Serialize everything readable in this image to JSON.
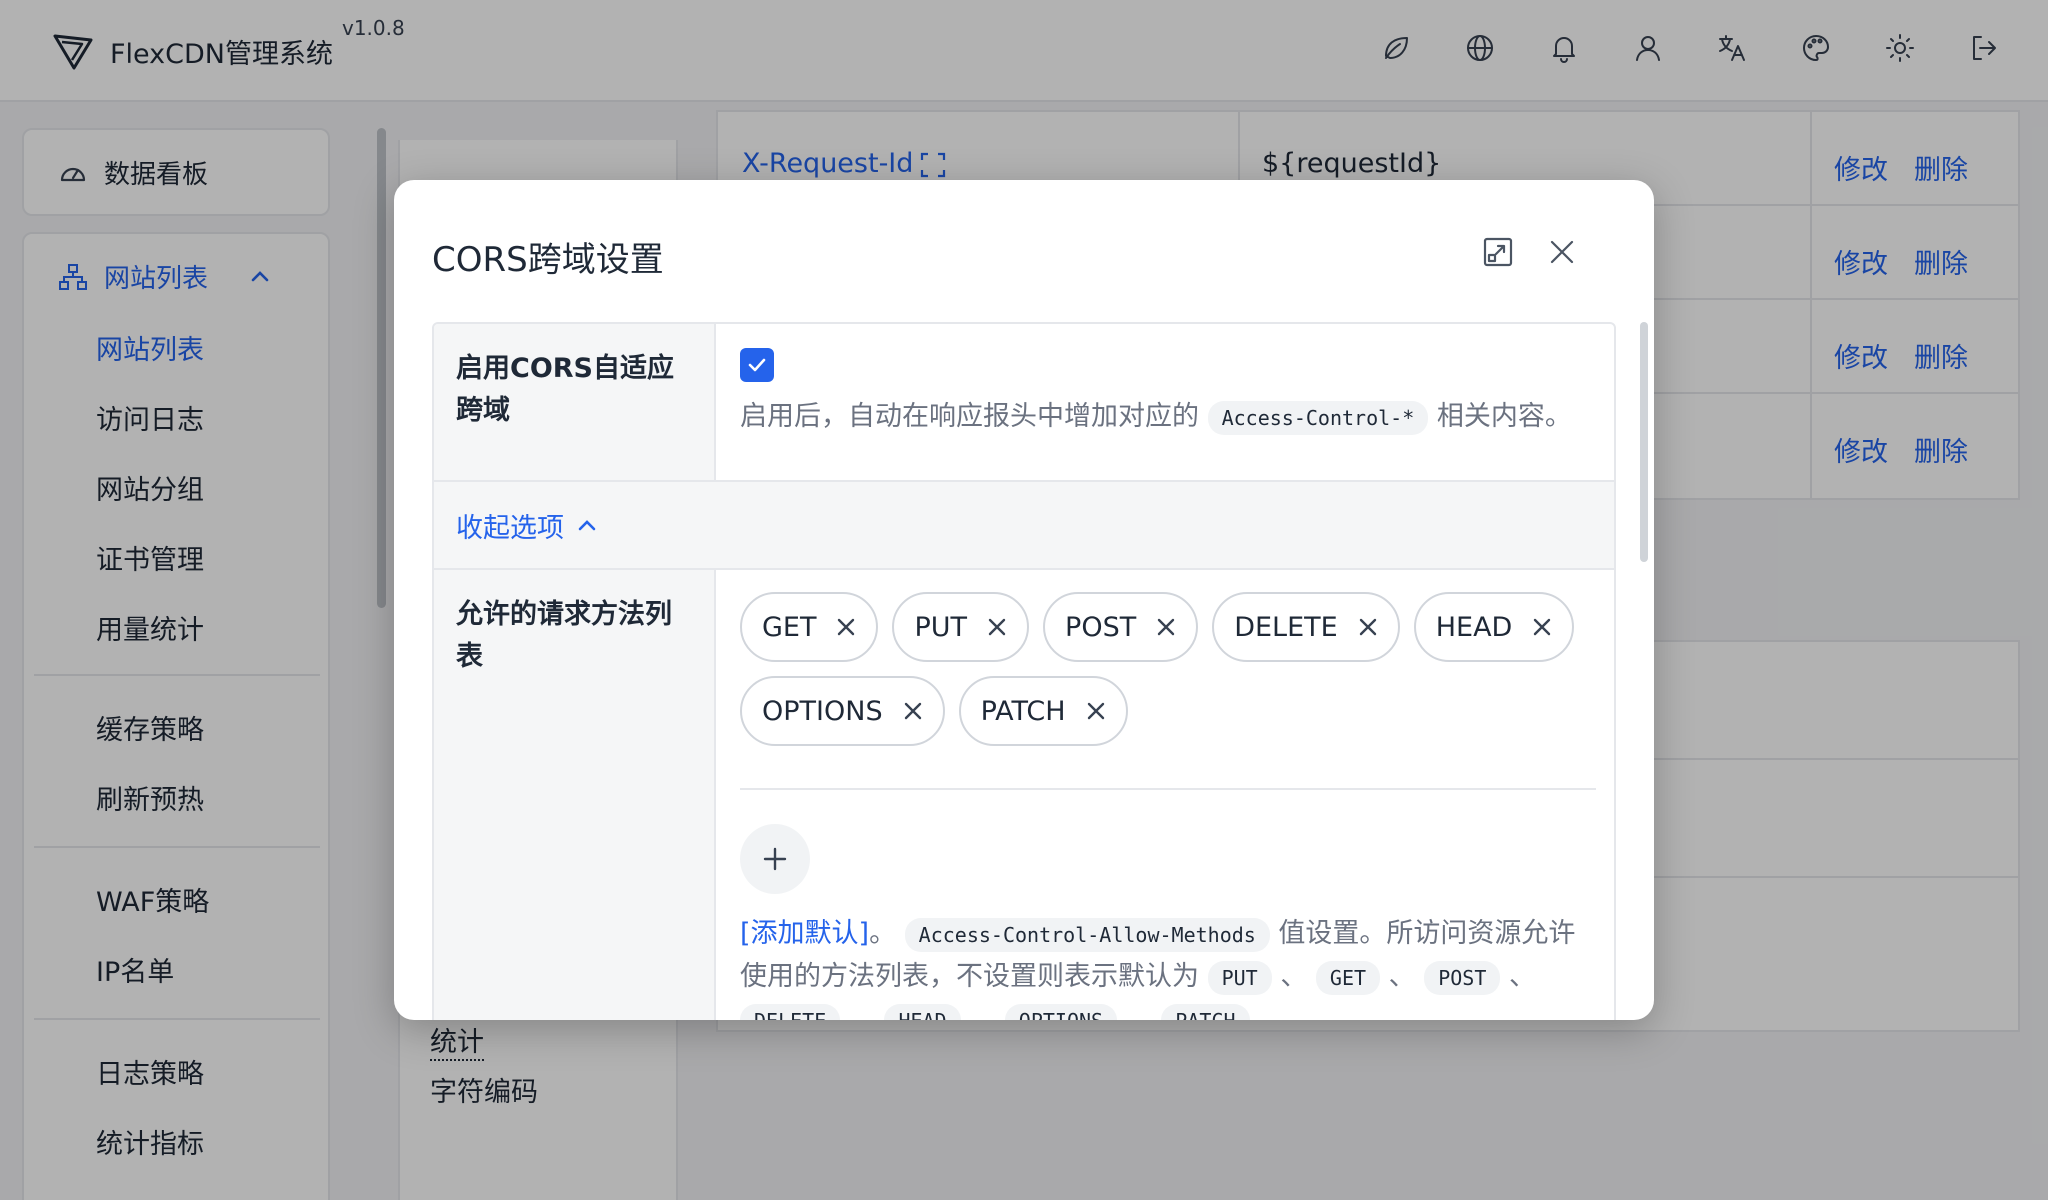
{
  "header": {
    "app_title": "FlexCDN管理系统",
    "version": "v1.0.8",
    "icons": [
      "leaf-icon",
      "globe-icon",
      "bell-icon",
      "user-icon",
      "translate-icon",
      "palette-icon",
      "sun-icon",
      "logout-icon"
    ]
  },
  "sidebar": {
    "dashboard_label": "数据看板",
    "sites_label": "网站列表",
    "items": [
      {
        "label": "网站列表",
        "active": true
      },
      {
        "label": "访问日志"
      },
      {
        "label": "网站分组"
      },
      {
        "label": "证书管理"
      },
      {
        "label": "用量统计"
      },
      {
        "label": "缓存策略"
      },
      {
        "label": "刷新预热"
      },
      {
        "label": "WAF策略"
      },
      {
        "label": "IP名单"
      },
      {
        "label": "日志策略"
      },
      {
        "label": "统计指标"
      }
    ]
  },
  "background": {
    "mid_items": [
      "统计",
      "字符编码"
    ],
    "table_rows": [
      {
        "name": "X-Request-Id",
        "value": "${requestId}",
        "edit": "修改",
        "delete": "删除"
      },
      {
        "edit": "修改",
        "delete": "删除"
      },
      {
        "edit": "修改",
        "delete": "删除"
      },
      {
        "edit": "修改",
        "delete": "删除"
      }
    ]
  },
  "modal": {
    "title": "CORS跨域设置",
    "enable_label": "启用CORS自适应跨域",
    "enable_checked": true,
    "enable_desc_before": "启用后，自动在响应报头中增加对应的",
    "enable_desc_code": "Access-Control-*",
    "enable_desc_after": "相关内容。",
    "collapse_label": "收起选项",
    "methods_label": "允许的请求方法列表",
    "methods": [
      "GET",
      "PUT",
      "POST",
      "DELETE",
      "HEAD",
      "OPTIONS",
      "PATCH"
    ],
    "methods_desc": {
      "add_default": "[添加默认]",
      "period": "。",
      "header_code": "Access-Control-Allow-Methods",
      "text1": "值设置。所访问资源允许使用的方法列表，不设置则表示默认为",
      "defaults": [
        "PUT",
        "GET",
        "POST",
        "DELETE",
        "HEAD",
        "OPTIONS",
        "PATCH"
      ],
      "sep": "、"
    }
  }
}
